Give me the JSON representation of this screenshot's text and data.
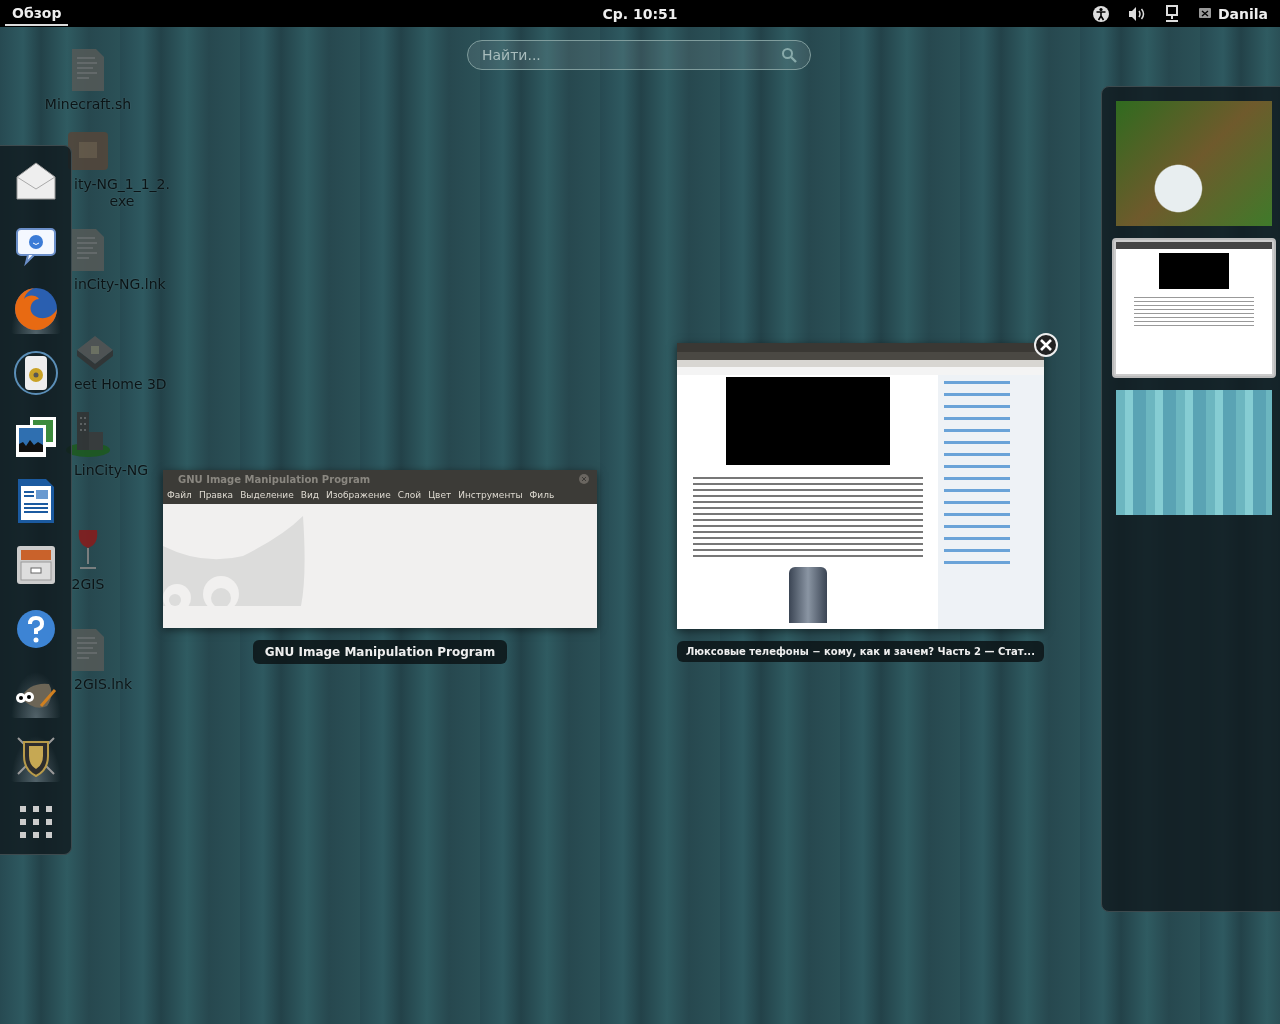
{
  "top_bar": {
    "activities": {
      "label": "Обзор",
      "selected": true
    },
    "clock": "Ср. 10:51",
    "user": "Danila"
  },
  "search": {
    "placeholder": "Найти..."
  },
  "desktop_icons": [
    {
      "kind": "script",
      "lines": [
        "Minecraft.sh"
      ]
    },
    {
      "kind": "package",
      "lines": [
        "ity-NG_1_1_2.",
        "exe"
      ]
    },
    {
      "kind": "text",
      "lines": [
        "inCity-NG.lnk"
      ]
    },
    {
      "kind": "house",
      "lines": [
        "eet Home 3D"
      ]
    },
    {
      "kind": "city",
      "lines": [
        "LinCity-NG"
      ]
    },
    {
      "kind": "wine",
      "lines": [
        "2GIS"
      ]
    },
    {
      "kind": "text",
      "lines": [
        "2GIS.lnk"
      ]
    }
  ],
  "dash": [
    {
      "kind": "mail",
      "running": false
    },
    {
      "kind": "chat",
      "running": false
    },
    {
      "kind": "browser",
      "running": true
    },
    {
      "kind": "speaker",
      "running": false
    },
    {
      "kind": "photos",
      "running": false
    },
    {
      "kind": "document",
      "running": false
    },
    {
      "kind": "cabinet",
      "running": false
    },
    {
      "kind": "help",
      "running": false
    },
    {
      "kind": "gimp",
      "running": true
    },
    {
      "kind": "shield",
      "running": true
    }
  ],
  "windows": [
    {
      "kind": "gimp",
      "title": "GNU Image Manipulation Program",
      "menu": [
        "Файл",
        "Правка",
        "Выделение",
        "Вид",
        "Изображение",
        "Слой",
        "Цвет",
        "Инструменты",
        "Филь"
      ],
      "caption": "GNU Image Manipulation Program",
      "closable": false
    },
    {
      "kind": "browser",
      "caption": "Люксовые телефоны − кому, как и зачем? Часть 2 — Стат...",
      "closable": true
    }
  ],
  "workspaces": [
    {
      "kind": "game",
      "selected": false
    },
    {
      "kind": "browser",
      "selected": true
    },
    {
      "kind": "desktop",
      "selected": false
    }
  ]
}
